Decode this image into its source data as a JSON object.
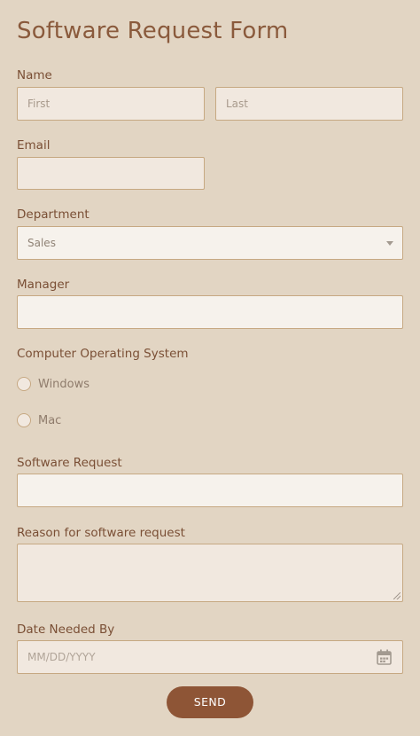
{
  "form": {
    "title": "Software Request Form",
    "name": {
      "label": "Name",
      "first_placeholder": "First",
      "last_placeholder": "Last"
    },
    "email": {
      "label": "Email"
    },
    "department": {
      "label": "Department",
      "selected": "Sales"
    },
    "manager": {
      "label": "Manager"
    },
    "os": {
      "label": "Computer Operating System",
      "options": [
        "Windows",
        "Mac"
      ]
    },
    "software_request": {
      "label": "Software Request"
    },
    "reason": {
      "label": "Reason for software request"
    },
    "date_needed": {
      "label": "Date Needed By",
      "placeholder": "MM/DD/YYYY"
    },
    "submit_label": "SEND"
  },
  "colors": {
    "background": "#e2d5c3",
    "accent": "#8e5536",
    "text": "#7a4f35",
    "field_border": "#c6a882"
  }
}
